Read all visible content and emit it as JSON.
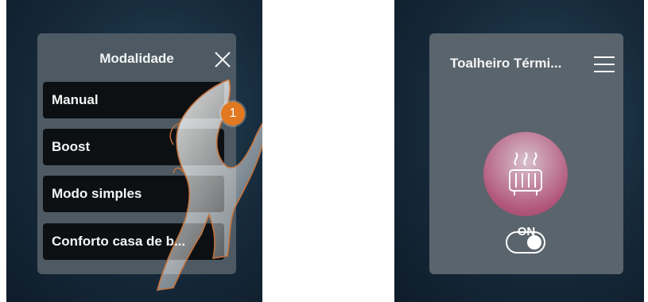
{
  "mode_panel": {
    "title": "Modalidade",
    "items": [
      {
        "label": "Manual"
      },
      {
        "label": "Boost"
      },
      {
        "label": "Modo simples"
      },
      {
        "label": "Conforto casa de b..."
      }
    ],
    "close_icon": "close-icon"
  },
  "step_badge": "1",
  "device_panel": {
    "title": "Toalheiro Térmi...",
    "menu_icon": "menu-icon",
    "heater_icon": "towel-heater-icon",
    "state": "ON",
    "toggle_on": true
  },
  "colors": {
    "background_dark": "#16293a",
    "panel": "#4e5a63",
    "item_bg": "#0d1012",
    "badge": "#e2781f",
    "accent_pink": "#b2577c"
  }
}
